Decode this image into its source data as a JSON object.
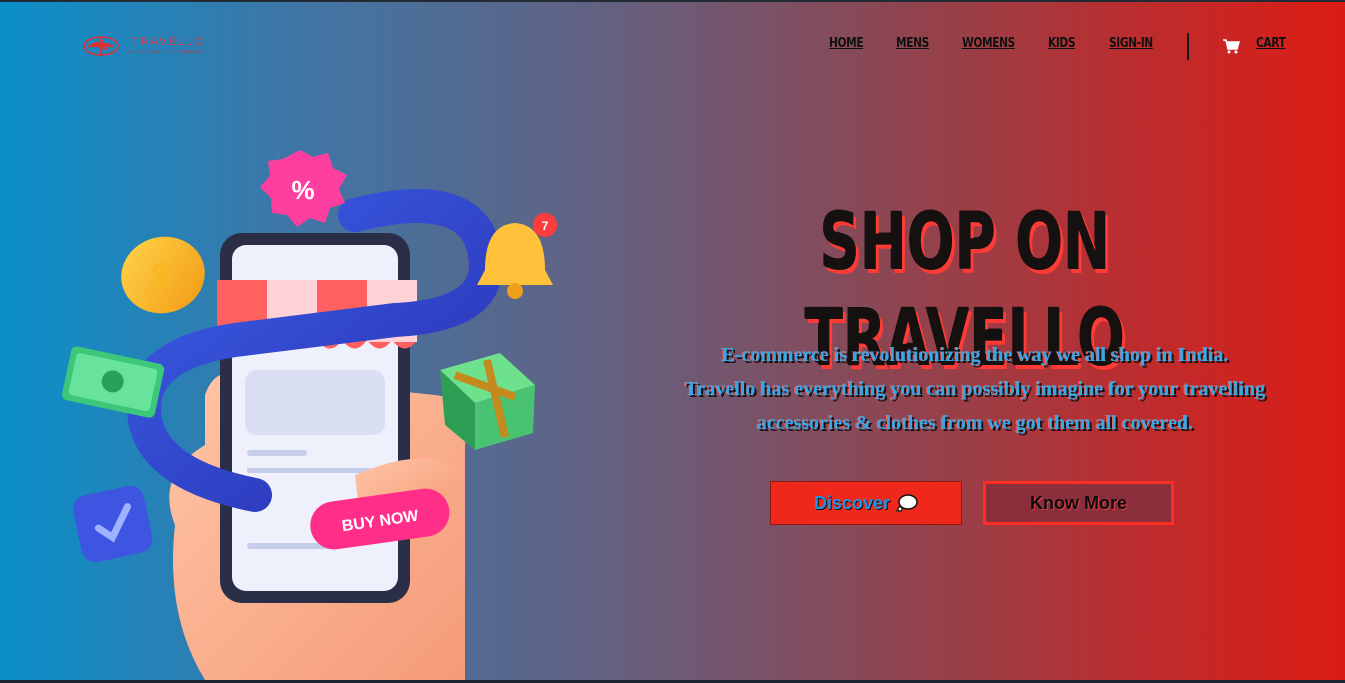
{
  "brand": {
    "name": "TRAVELLO",
    "tagline": "LET'S START THE JOURNEY"
  },
  "nav": {
    "items": [
      {
        "label": "HOME"
      },
      {
        "label": "MENS"
      },
      {
        "label": "WOMENS"
      },
      {
        "label": "KIDS"
      },
      {
        "label": "SIGN-IN"
      }
    ],
    "cart_label": "CART",
    "cart_icon": "cart-icon"
  },
  "hero": {
    "title": "SHOP ON TRAVELLO",
    "description_lines": [
      "E-commerce is revolutionizing the way we all shop in India.",
      "Travello has everything you can possibly imagine for your travelling",
      "accessories & clothes from we got them all covered."
    ],
    "discover_label": "Discover",
    "discover_icon": "speech-bubble-icon",
    "know_more_label": "Know More"
  },
  "illustration": {
    "buy_now_label": "BUY NOW",
    "discount_badge": "%",
    "notification_count": "7"
  },
  "colors": {
    "gradient_start": "#0a8fc9",
    "gradient_end": "#dc1c14",
    "accent_red": "#f0281b",
    "text_dark": "#151111"
  }
}
